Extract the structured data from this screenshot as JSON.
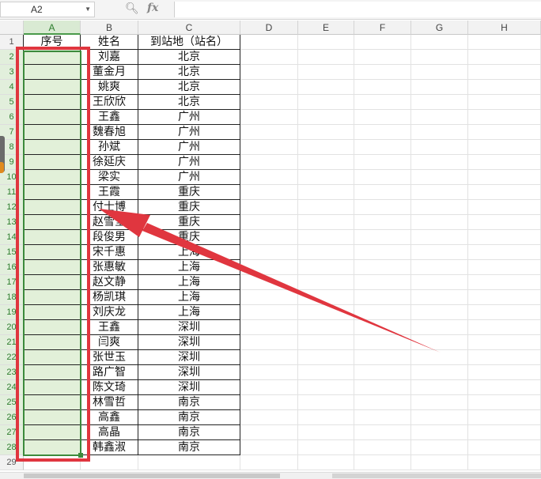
{
  "formula_bar": {
    "name_box": "A2",
    "zoom_icon": "zoom-icon",
    "fx_label": "fx",
    "formula": ""
  },
  "columns": [
    "A",
    "B",
    "C",
    "D",
    "E",
    "F",
    "G",
    "H"
  ],
  "rows": [
    "1",
    "2",
    "3",
    "4",
    "5",
    "6",
    "7",
    "8",
    "9",
    "10",
    "11",
    "12",
    "13",
    "14",
    "15",
    "16",
    "17",
    "18",
    "19",
    "20",
    "21",
    "22",
    "23",
    "24",
    "25",
    "26",
    "27",
    "28",
    "29"
  ],
  "header_row": {
    "a": "序号",
    "b": "姓名",
    "c": "到站地（站名）"
  },
  "data_rows": [
    {
      "name": "刘嘉",
      "station": "北京"
    },
    {
      "name": "董金月",
      "station": "北京"
    },
    {
      "name": "姚爽",
      "station": "北京"
    },
    {
      "name": "王欣欣",
      "station": "北京"
    },
    {
      "name": "王鑫",
      "station": "广州"
    },
    {
      "name": "魏春旭",
      "station": "广州"
    },
    {
      "name": "孙斌",
      "station": "广州"
    },
    {
      "name": "徐延庆",
      "station": "广州"
    },
    {
      "name": "梁实",
      "station": "广州"
    },
    {
      "name": "王霞",
      "station": "重庆"
    },
    {
      "name": "付士博",
      "station": "重庆"
    },
    {
      "name": "赵雪莹",
      "station": "重庆"
    },
    {
      "name": "段俊男",
      "station": "重庆"
    },
    {
      "name": "宋千惠",
      "station": "上海"
    },
    {
      "name": "张惠敏",
      "station": "上海"
    },
    {
      "name": "赵文静",
      "station": "上海"
    },
    {
      "name": "杨凯琪",
      "station": "上海"
    },
    {
      "name": "刘庆龙",
      "station": "上海"
    },
    {
      "name": "王鑫",
      "station": "深圳"
    },
    {
      "name": "闫爽",
      "station": "深圳"
    },
    {
      "name": "张世玉",
      "station": "深圳"
    },
    {
      "name": "路广智",
      "station": "深圳"
    },
    {
      "name": "陈文琦",
      "station": "深圳"
    },
    {
      "name": "林雪哲",
      "station": "南京"
    },
    {
      "name": "高鑫",
      "station": "南京"
    },
    {
      "name": "高晶",
      "station": "南京"
    },
    {
      "name": "韩鑫淑",
      "station": "南京"
    }
  ],
  "colors": {
    "selection": "#3c8a3c",
    "selection_fill": "#e2f0d9",
    "annotation": "#e0363f"
  }
}
